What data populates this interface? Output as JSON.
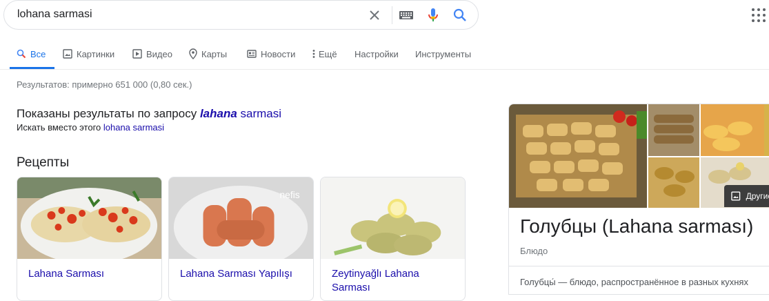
{
  "search": {
    "query": "lohana sarmasi"
  },
  "tabs": [
    {
      "label": "Все",
      "icon": "search-icon"
    },
    {
      "label": "Картинки",
      "icon": "image-icon"
    },
    {
      "label": "Видео",
      "icon": "video-icon"
    },
    {
      "label": "Карты",
      "icon": "map-pin-icon"
    },
    {
      "label": "Новости",
      "icon": "news-icon"
    },
    {
      "label": "Ещё",
      "icon": "more-vert-icon"
    },
    {
      "label": "Настройки"
    },
    {
      "label": "Инструменты"
    }
  ],
  "results": {
    "stats": "Результатов: примерно 651 000 (0,80 сек.)",
    "spell_prefix": "Показаны результаты по запросу",
    "spell_bold": "lahana",
    "spell_rest": "sarmasi",
    "instead_prefix": "Искать вместо этого",
    "instead_link": "lohana sarmasi"
  },
  "recipes": {
    "heading": "Рецепты",
    "items": [
      {
        "title": "Lahana Sarması"
      },
      {
        "title": "Lahana Sarması Yapılışı",
        "watermark": "nefis"
      },
      {
        "title": "Zeytinyağlı Lahana Sarması"
      }
    ]
  },
  "knowledge_panel": {
    "title": "Голубцы (Lahana sarması)",
    "subtitle": "Блюдо",
    "description": "Голубцы́ — блюдо, распространённое в разных кухнях",
    "other_photos": "Другие"
  },
  "colors": {
    "accent": "#1a73e8",
    "link": "#1a0dab",
    "muted": "#70757a"
  }
}
